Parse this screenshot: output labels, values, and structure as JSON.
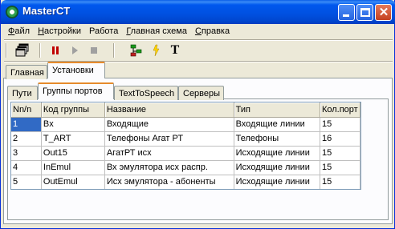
{
  "window": {
    "title": "MasterCT",
    "close_glyph": "✕"
  },
  "menu": [
    {
      "label": "Файл",
      "accel": "Ф",
      "rest": "айл"
    },
    {
      "label": "Настройки",
      "accel": "Н",
      "rest": "астройки"
    },
    {
      "label": "Работа",
      "accel": "Р",
      "rest": "абота"
    },
    {
      "label": "Главная схема",
      "accel": "Г",
      "rest": "лавная схема"
    },
    {
      "label": "Справка",
      "accel": "С",
      "rest": "правка"
    }
  ],
  "toolbar": {
    "text_tool_label": "T",
    "icons": [
      "windows-icon",
      "pause-icon",
      "play-icon",
      "stop-icon",
      "network-icon",
      "bolt-icon",
      "text-icon"
    ]
  },
  "outer_tabs": [
    {
      "label": "Главная",
      "active": false
    },
    {
      "label": "Установки",
      "active": true
    }
  ],
  "inner_tabs": [
    {
      "label": "Пути",
      "active": false
    },
    {
      "label": "Группы портов",
      "active": true
    },
    {
      "label": "TextToSpeech",
      "active": false
    },
    {
      "label": "Серверы",
      "active": false
    }
  ],
  "grid": {
    "columns": [
      "Nn/n",
      "Код группы",
      "Название",
      "Тип",
      "Кол.порт"
    ],
    "rows": [
      [
        "1",
        "Bx",
        "Входящие",
        "Входящие линии",
        "15"
      ],
      [
        "2",
        "T_ART",
        "Телефоны Агат РТ",
        "Телефоны",
        "16"
      ],
      [
        "3",
        "Out15",
        "АгатРТ исх",
        "Исходящие линии",
        "15"
      ],
      [
        "4",
        "InEmul",
        "Вх эмулятора исх распр.",
        "Исходящие линии",
        "15"
      ],
      [
        "5",
        "OutEmul",
        "Исх эмулятора - абоненты",
        "Исходящие линии",
        "15"
      ]
    ],
    "selected_row": 0
  },
  "colors": {
    "titlebar": "#0054e3",
    "selection": "#316ac5",
    "tab_highlight": "#e68b2c"
  }
}
